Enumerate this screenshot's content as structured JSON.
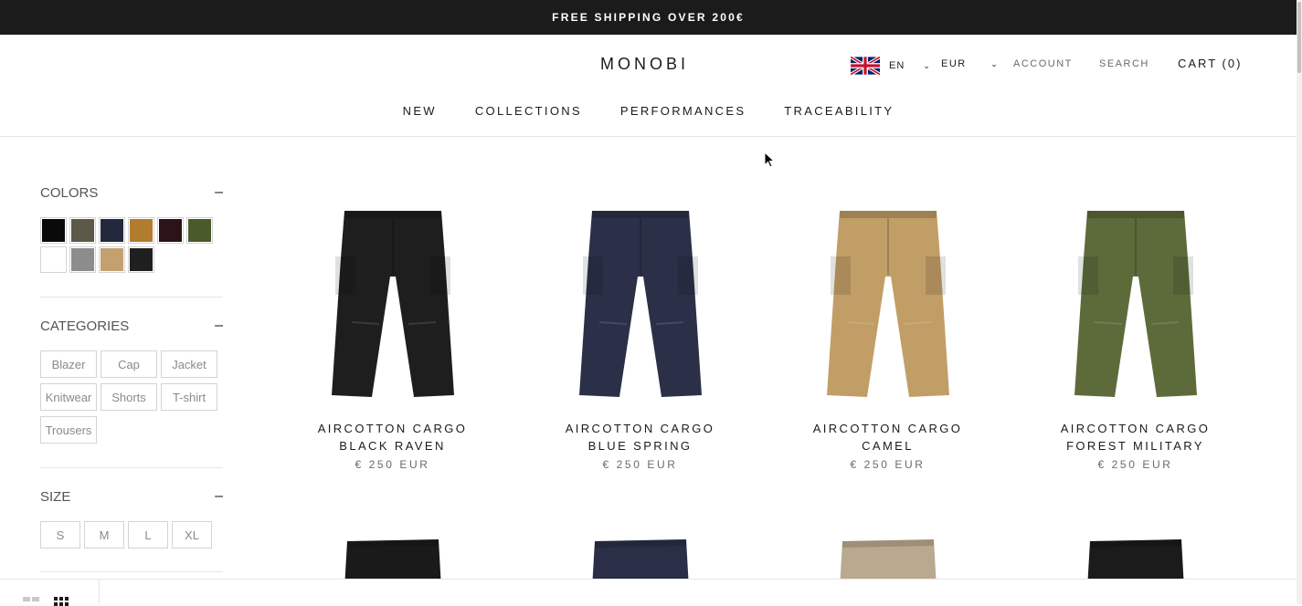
{
  "announcement": "FREE SHIPPING OVER 200€",
  "header": {
    "logo": "MONOBI",
    "language": "EN",
    "currency": "EUR",
    "account": "ACCOUNT",
    "search": "SEARCH",
    "cart": "CART (0)"
  },
  "nav": [
    "NEW",
    "COLLECTIONS",
    "PERFORMANCES",
    "TRACEABILITY"
  ],
  "filters": {
    "colors_title": "COLORS",
    "colors": [
      "#0a0a0a",
      "#5d5848",
      "#23283d",
      "#b27c2e",
      "#2c1318",
      "#4b5a2a",
      "#ffffff",
      "#8c8c8c",
      "#c3a070",
      "#1f1f1f"
    ],
    "categories_title": "CATEGORIES",
    "categories": [
      "Blazer",
      "Cap",
      "Jacket",
      "Knitwear",
      "Shorts",
      "T-shirt",
      "Trousers"
    ],
    "size_title": "SIZE",
    "sizes": [
      "S",
      "M",
      "L",
      "XL"
    ],
    "collapse_symbol": "–"
  },
  "products": [
    {
      "name1": "AIRCOTTON CARGO",
      "name2": "BLACK RAVEN",
      "price": "€ 250 EUR",
      "color": "#1e1e1e"
    },
    {
      "name1": "AIRCOTTON CARGO",
      "name2": "BLUE SPRING",
      "price": "€ 250 EUR",
      "color": "#2b3048"
    },
    {
      "name1": "AIRCOTTON CARGO",
      "name2": "CAMEL",
      "price": "€ 250 EUR",
      "color": "#c29e67"
    },
    {
      "name1": "AIRCOTTON CARGO",
      "name2": "FOREST MILITARY",
      "price": "€ 250 EUR",
      "color": "#5d6b3b"
    }
  ],
  "row2_colors": [
    "#1a1a1a",
    "#2a2e46",
    "#b9a98e",
    "#1b1b1b"
  ]
}
